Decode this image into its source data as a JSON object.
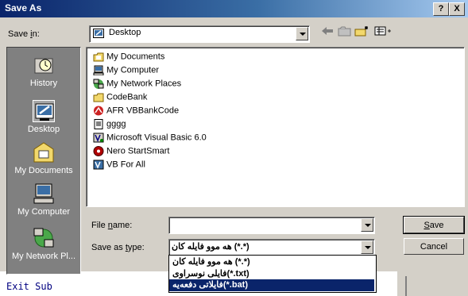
{
  "window": {
    "title": "Save As",
    "help_label": "?",
    "close_label": "X"
  },
  "save_in": {
    "label_pre": "Save ",
    "label_u": "i",
    "label_post": "n:",
    "value": "Desktop"
  },
  "toolbar": {
    "back_icon": "back-arrow-icon",
    "up_icon": "up-folder-icon",
    "new_folder_icon": "new-folder-icon",
    "views_icon": "views-menu-icon"
  },
  "places": [
    {
      "label": "History"
    },
    {
      "label": "Desktop"
    },
    {
      "label": "My Documents"
    },
    {
      "label": "My Computer"
    },
    {
      "label": "My Network Pl..."
    }
  ],
  "files": [
    {
      "label": "My Documents",
      "icon": "my-documents-folder-icon"
    },
    {
      "label": "My Computer",
      "icon": "my-computer-icon"
    },
    {
      "label": "My Network Places",
      "icon": "network-places-icon"
    },
    {
      "label": "CodeBank",
      "icon": "folder-icon"
    },
    {
      "label": "AFR VBBankCode",
      "icon": "shortcut-icon"
    },
    {
      "label": "gggg",
      "icon": "text-file-icon"
    },
    {
      "label": "Microsoft Visual Basic 6.0",
      "icon": "vb6-icon"
    },
    {
      "label": "Nero StartSmart",
      "icon": "nero-icon"
    },
    {
      "label": "VB For All",
      "icon": "vb-shortcut-icon"
    }
  ],
  "file_name": {
    "label_pre": "File ",
    "label_u": "n",
    "label_post": "ame:",
    "value": ""
  },
  "save_type": {
    "label_pre": "Save as ",
    "label_u": "t",
    "label_post": "ype:",
    "value": "هه موو فایله کان (*.*)"
  },
  "type_options": [
    {
      "label": "هه موو فایله کان (*.*)",
      "selected": false
    },
    {
      "label": "فایلی نوسراوی(*.txt)",
      "selected": false
    },
    {
      "label": "فایلاتی دفعه‌یه(*.bat)",
      "selected": true
    }
  ],
  "buttons": {
    "save_u": "S",
    "save_rest": "ave",
    "cancel": "Cancel"
  },
  "background_code": "Exit Sub",
  "colors": {
    "face": "#d4d0c8",
    "title_start": "#0a246a",
    "title_end": "#a6caf0",
    "places_bg": "#808080",
    "selection": "#0a246a"
  }
}
